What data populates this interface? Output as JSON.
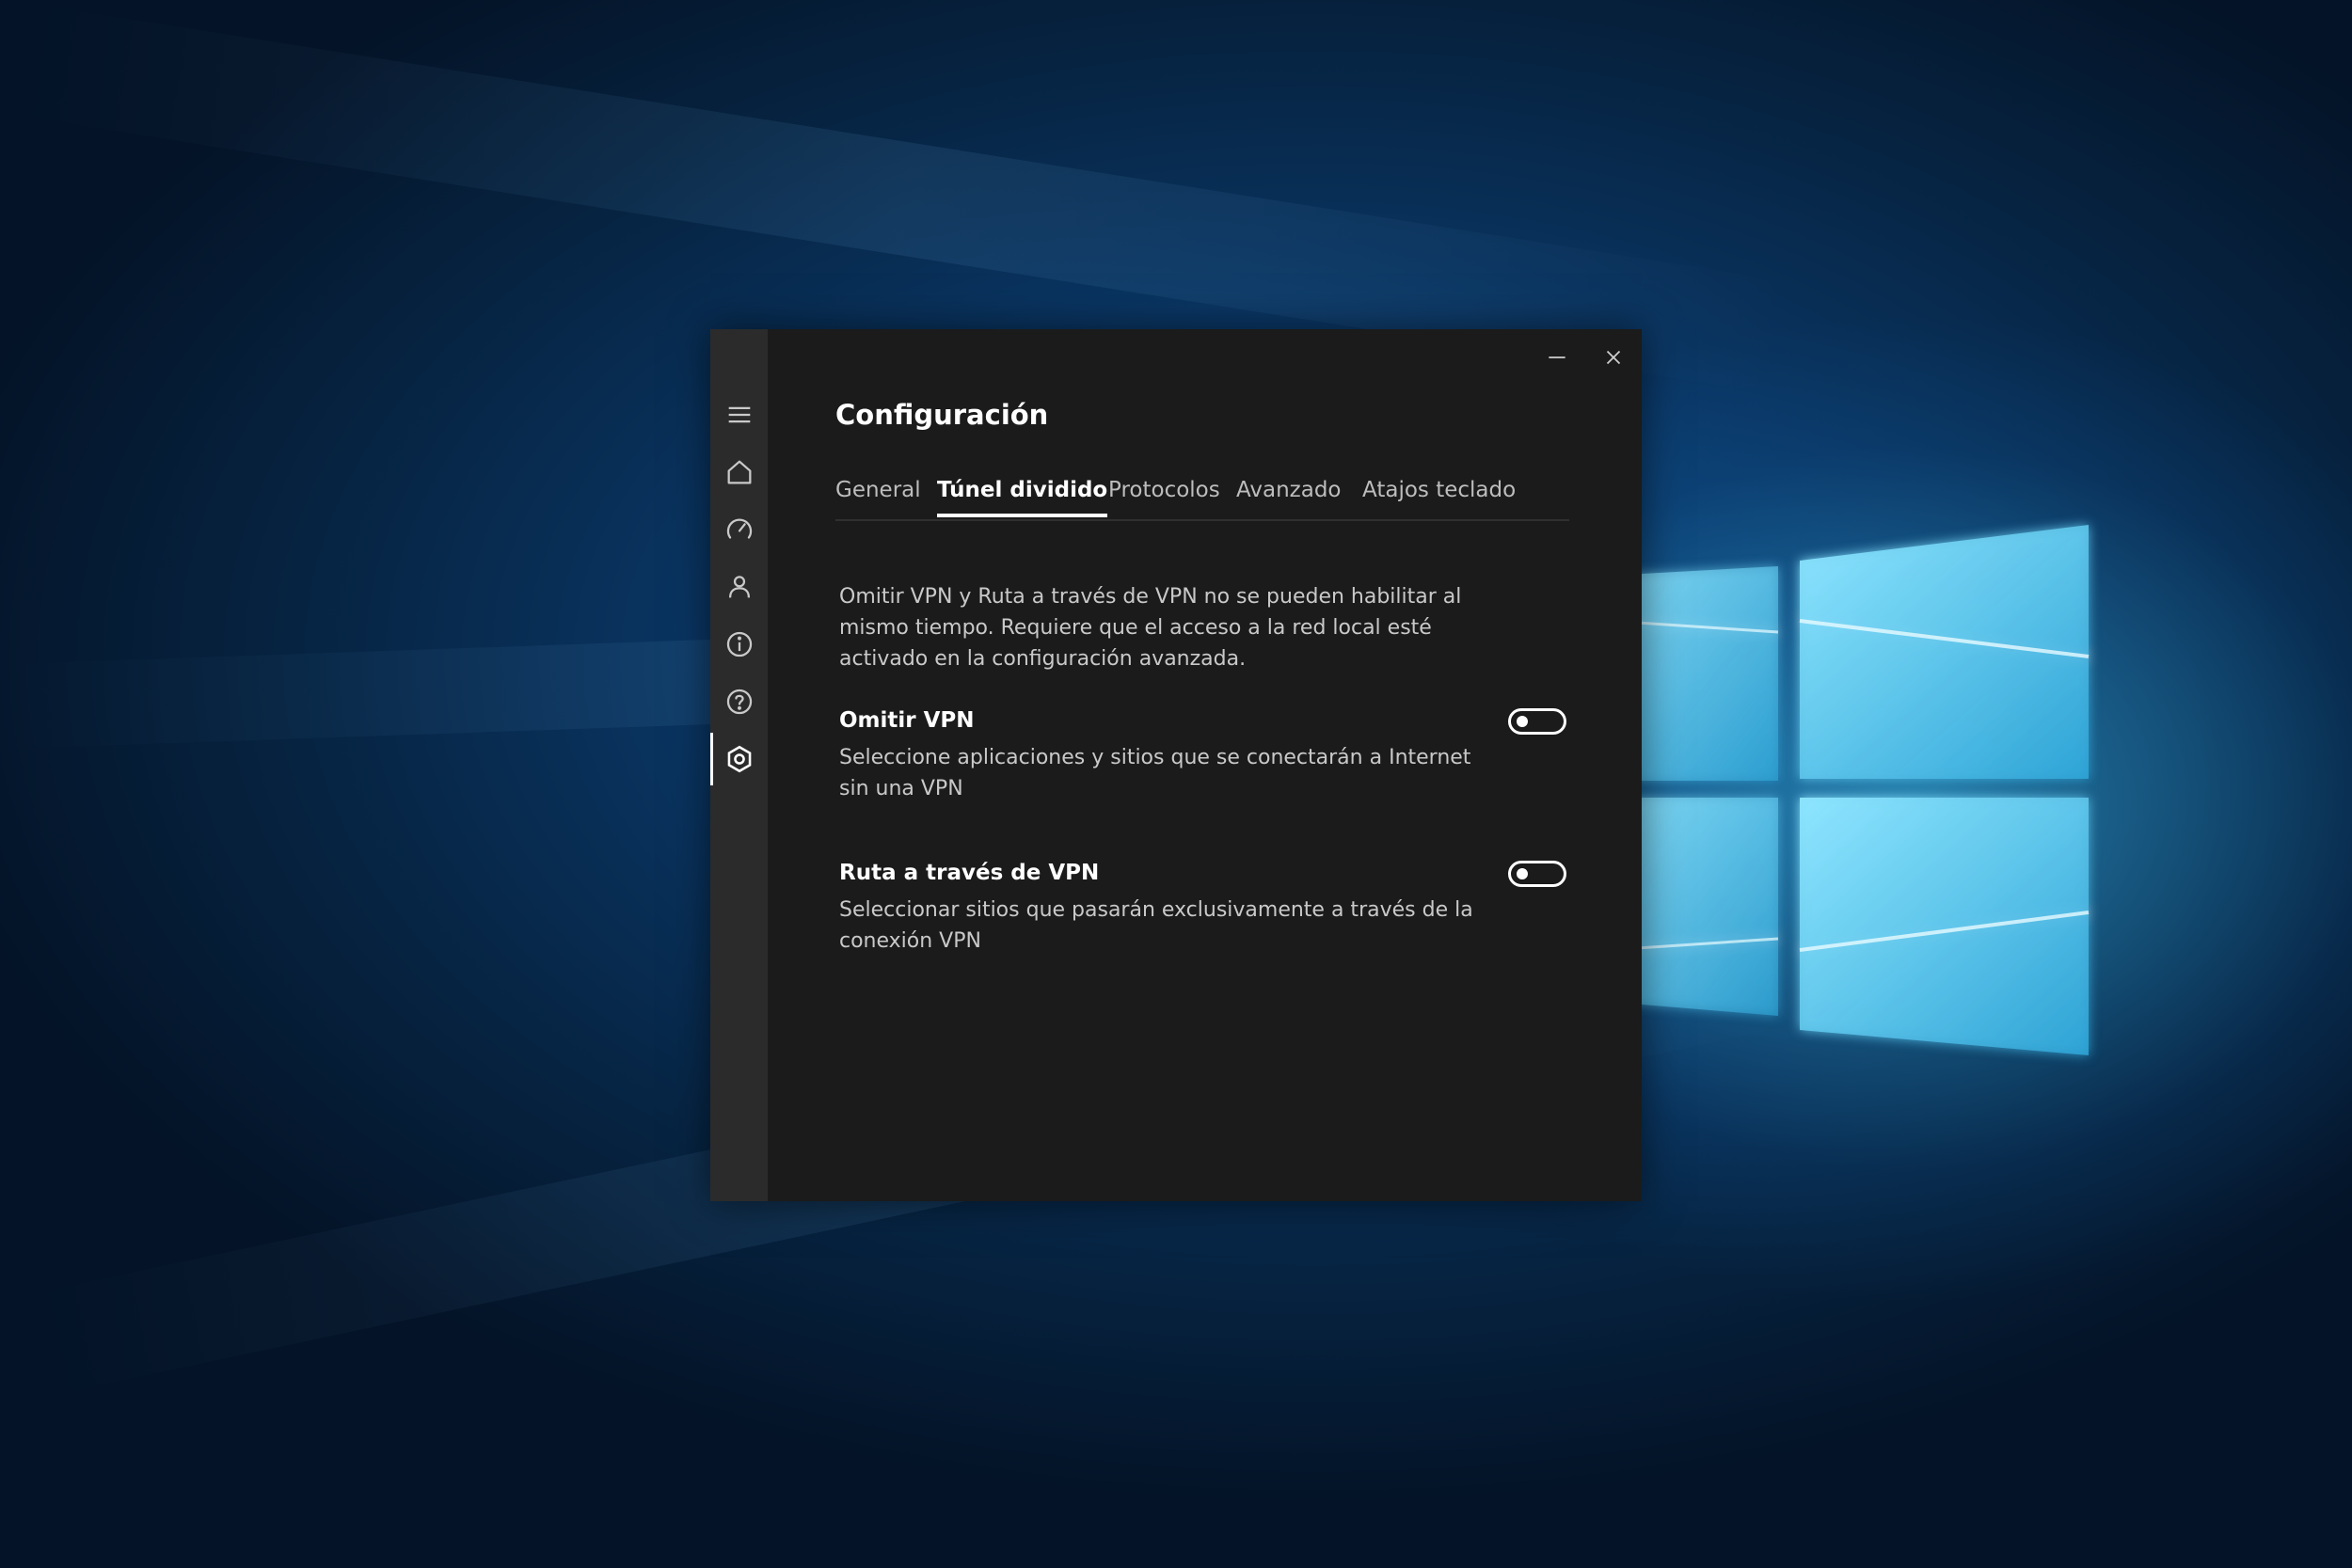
{
  "window": {
    "title": "Configuración"
  },
  "titlebar": {
    "minimize_icon": "minimize-icon",
    "close_icon": "close-icon"
  },
  "sidebar": {
    "items": [
      {
        "icon": "menu-icon",
        "active": false
      },
      {
        "icon": "home-icon",
        "active": false
      },
      {
        "icon": "speed-icon",
        "active": false
      },
      {
        "icon": "account-icon",
        "active": false
      },
      {
        "icon": "info-icon",
        "active": false
      },
      {
        "icon": "help-icon",
        "active": false
      },
      {
        "icon": "settings-icon",
        "active": true
      }
    ]
  },
  "tabs": [
    {
      "label": "General",
      "active": false
    },
    {
      "label": "Túnel dividido",
      "active": true
    },
    {
      "label": "Protocolos",
      "active": false
    },
    {
      "label": "Avanzado",
      "active": false
    },
    {
      "label": "Atajos teclado",
      "active": false
    }
  ],
  "content": {
    "intro": "Omitir VPN y Ruta a través de VPN no se pueden habilitar al mismo tiempo. Requiere que el acceso a la red local esté activado en la configuración avanzada.",
    "settings": [
      {
        "title": "Omitir VPN",
        "description": "Seleccione aplicaciones y sitios que se conectarán a Internet sin una VPN",
        "enabled": false
      },
      {
        "title": "Ruta a través de VPN",
        "description": "Seleccionar sitios que pasarán exclusivamente a través de la conexión VPN",
        "enabled": false
      }
    ]
  },
  "colors": {
    "window_bg": "#1b1b1b",
    "sidebar_bg": "#2b2b2b",
    "text_primary": "#ffffff",
    "text_secondary": "#c9c9c9",
    "desktop_accent": "#3cbeeb"
  }
}
